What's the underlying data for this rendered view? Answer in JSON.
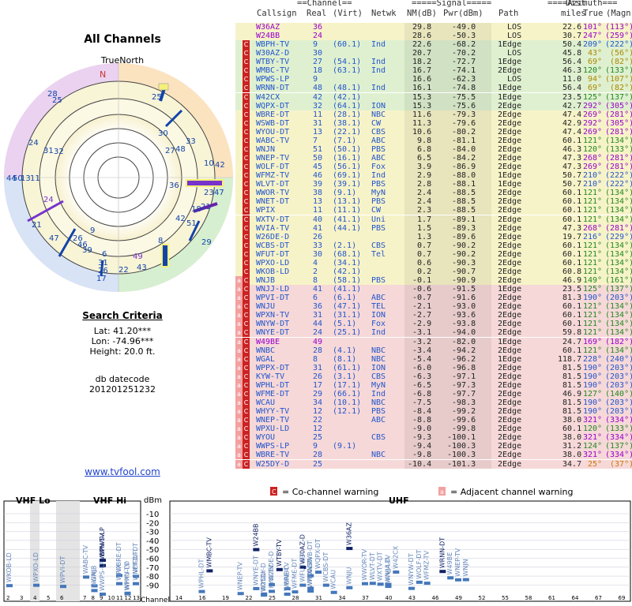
{
  "left_panel": {
    "title": "All Channels",
    "true_north_label": "TrueNorth",
    "north_marker": "N",
    "search_criteria_title": "Search Criteria",
    "lat": "Lat: 41.20***",
    "lon": "Lon: -74.96***",
    "height": "Height: 20.0 ft.",
    "db_label": "db datecode",
    "db_value": "201201251232",
    "website": "www.tvfool.com"
  },
  "table": {
    "group_headers": {
      "channel": "==Channel==",
      "signal": "=====Signal=====",
      "azimuth": "====Azimuth==="
    },
    "col_headers": {
      "callsign": "Callsign",
      "real": "Real",
      "virt": "(Virt)",
      "netwk": "Netwk",
      "nm": "NM(dB)",
      "pwr": "Pwr(dBm)",
      "path": "Path",
      "dist_top": "Dist",
      "dist": "miles",
      "true": "True",
      "magn": "(Magn)"
    },
    "rows": [
      [
        "",
        "W36AZ",
        "36",
        "",
        "",
        "29.8",
        "-49.0",
        "LOS",
        "22.6",
        "101°",
        "(113°)",
        "purple"
      ],
      [
        "",
        "W24BB",
        "24",
        "",
        "",
        "28.6",
        "-50.3",
        "LOS",
        "30.7",
        "247°",
        "(259°)",
        "purple"
      ],
      [
        "C",
        "WBPH-TV",
        "9",
        "(60.1)",
        "Ind",
        "22.6",
        "-68.2",
        "1Edge",
        "50.4",
        "209°",
        "(222°)",
        "blue"
      ],
      [
        "C",
        "W30AZ-D",
        "30",
        "",
        "",
        "20.7",
        "-70.2",
        "LOS",
        "45.8",
        "43°",
        "(56°)",
        "olive"
      ],
      [
        "C",
        "WTBY-TV",
        "27",
        "(54.1)",
        "Ind",
        "18.2",
        "-72.7",
        "1Edge",
        "56.4",
        "69°",
        "(82°)",
        "olive"
      ],
      [
        "C",
        "WMBC-TV",
        "18",
        "(63.1)",
        "Ind",
        "16.7",
        "-74.1",
        "2Edge",
        "46.3",
        "120°",
        "(133°)",
        "green"
      ],
      [
        "C",
        "WPWS-LP",
        "9",
        "",
        "",
        "16.6",
        "-62.3",
        "LOS",
        "11.0",
        "94°",
        "(107°)",
        "olive"
      ],
      [
        "C",
        "WRNN-DT",
        "48",
        "(48.1)",
        "Ind",
        "16.1",
        "-74.8",
        "1Edge",
        "56.4",
        "69°",
        "(82°)",
        "olive"
      ],
      [
        "C",
        "W42CX",
        "42",
        "(42.1)",
        "",
        "15.3",
        "-75.5",
        "1Edge",
        "23.5",
        "125°",
        "(137°)",
        "green"
      ],
      [
        "C",
        "WQPX-DT",
        "32",
        "(64.1)",
        "ION",
        "15.3",
        "-75.6",
        "2Edge",
        "42.7",
        "292°",
        "(305°)",
        "purple"
      ],
      [
        "C",
        "WBRE-DT",
        "11",
        "(28.1)",
        "NBC",
        "11.6",
        "-79.3",
        "2Edge",
        "47.4",
        "269°",
        "(281°)",
        "purple"
      ],
      [
        "C",
        "WSWB-DT",
        "31",
        "(38.1)",
        "CW",
        "11.3",
        "-79.6",
        "2Edge",
        "42.9",
        "292°",
        "(305°)",
        "purple"
      ],
      [
        "C",
        "WYOU-DT",
        "13",
        "(22.1)",
        "CBS",
        "10.6",
        "-80.2",
        "2Edge",
        "47.4",
        "269°",
        "(281°)",
        "purple"
      ],
      [
        "C",
        "WABC-TV",
        "7",
        "(7.1)",
        "ABC",
        "9.8",
        "-81.1",
        "2Edge",
        "60.1",
        "121°",
        "(134°)",
        "green"
      ],
      [
        "C",
        "WNJN",
        "51",
        "(50.1)",
        "PBS",
        "6.8",
        "-84.0",
        "2Edge",
        "46.3",
        "120°",
        "(133°)",
        "green"
      ],
      [
        "C",
        "WNEP-TV",
        "50",
        "(16.1)",
        "ABC",
        "6.5",
        "-84.2",
        "2Edge",
        "47.3",
        "268°",
        "(281°)",
        "purple"
      ],
      [
        "C",
        "WOLF-DT",
        "45",
        "(56.1)",
        "Fox",
        "3.9",
        "-86.9",
        "2Edge",
        "47.3",
        "269°",
        "(281°)",
        "purple"
      ],
      [
        "C",
        "WFMZ-TV",
        "46",
        "(69.1)",
        "Ind",
        "2.9",
        "-88.0",
        "1Edge",
        "50.7",
        "210°",
        "(222°)",
        "blue"
      ],
      [
        "C",
        "WLVT-DT",
        "39",
        "(39.1)",
        "PBS",
        "2.8",
        "-88.1",
        "1Edge",
        "50.7",
        "210°",
        "(222°)",
        "blue"
      ],
      [
        "C",
        "WWOR-TV",
        "38",
        "(9.1)",
        "MyN",
        "2.4",
        "-88.5",
        "2Edge",
        "60.1",
        "121°",
        "(134°)",
        "green"
      ],
      [
        "C",
        "WNET-DT",
        "13",
        "(13.1)",
        "PBS",
        "2.4",
        "-88.5",
        "2Edge",
        "60.1",
        "121°",
        "(134°)",
        "green"
      ],
      [
        "C",
        "WPIX",
        "11",
        "(11.1)",
        "CW",
        "2.3",
        "-88.5",
        "2Edge",
        "60.1",
        "121°",
        "(134°)",
        "green"
      ],
      [
        "C",
        "WXTV-DT",
        "40",
        "(41.1)",
        "Uni",
        "1.7",
        "-89.1",
        "2Edge",
        "60.1",
        "121°",
        "(134°)",
        "green"
      ],
      [
        "C",
        "WVIA-TV",
        "41",
        "(44.1)",
        "PBS",
        "1.5",
        "-89.3",
        "2Edge",
        "47.3",
        "268°",
        "(281°)",
        "purple"
      ],
      [
        "C",
        "W26DE-D",
        "26",
        "",
        "",
        "1.3",
        "-89.6",
        "2Edge",
        "19.7",
        "216°",
        "(229°)",
        "blue"
      ],
      [
        "C",
        "WCBS-DT",
        "33",
        "(2.1)",
        "CBS",
        "0.7",
        "-90.2",
        "2Edge",
        "60.1",
        "121°",
        "(134°)",
        "green"
      ],
      [
        "C",
        "WFUT-DT",
        "30",
        "(68.1)",
        "Tel",
        "0.7",
        "-90.2",
        "2Edge",
        "60.1",
        "121°",
        "(134°)",
        "green"
      ],
      [
        "C",
        "WPXO-LD",
        "4",
        "(34.1)",
        "",
        "0.6",
        "-90.3",
        "2Edge",
        "60.1",
        "121°",
        "(134°)",
        "green"
      ],
      [
        "C",
        "WKOB-LD",
        "2",
        "(42.1)",
        "",
        "0.2",
        "-90.7",
        "2Edge",
        "60.8",
        "121°",
        "(134°)",
        "green"
      ],
      [
        "AC",
        "WNJB",
        "8",
        "(58.1)",
        "PBS",
        "-0.1",
        "-90.9",
        "2Edge",
        "46.9",
        "149°",
        "(161°)",
        "green"
      ],
      [
        "AC",
        "WNJJ-LD",
        "41",
        "(41.1)",
        "",
        "-0.6",
        "-91.5",
        "1Edge",
        "23.5",
        "125°",
        "(137°)",
        "green"
      ],
      [
        "AC",
        "WPVI-DT",
        "6",
        "(6.1)",
        "ABC",
        "-0.7",
        "-91.6",
        "2Edge",
        "81.3",
        "190°",
        "(203°)",
        "blue"
      ],
      [
        "AC",
        "WNJU",
        "36",
        "(47.1)",
        "TEL",
        "-2.1",
        "-93.0",
        "2Edge",
        "60.1",
        "121°",
        "(134°)",
        "green"
      ],
      [
        "AC",
        "WPXN-TV",
        "31",
        "(31.1)",
        "ION",
        "-2.7",
        "-93.6",
        "2Edge",
        "60.1",
        "121°",
        "(134°)",
        "green"
      ],
      [
        "AC",
        "WNYW-DT",
        "44",
        "(5.1)",
        "Fox",
        "-2.9",
        "-93.8",
        "2Edge",
        "60.1",
        "121°",
        "(134°)",
        "green"
      ],
      [
        "AC",
        "WNYE-DT",
        "24",
        "(25.1)",
        "Ind",
        "-3.1",
        "-94.0",
        "2Edge",
        "59.8",
        "121°",
        "(134°)",
        "green"
      ],
      [
        "AC",
        "W49BE",
        "49",
        "",
        "",
        "-3.2",
        "-82.0",
        "1Edge",
        "24.7",
        "169°",
        "(182°)",
        "purple"
      ],
      [
        "AC",
        "WNBC",
        "28",
        "(4.1)",
        "NBC",
        "-3.4",
        "-94.2",
        "2Edge",
        "60.1",
        "121°",
        "(134°)",
        "green"
      ],
      [
        "AC",
        "WGAL",
        "8",
        "(8.1)",
        "NBC",
        "-5.4",
        "-96.2",
        "1Edge",
        "118.7",
        "228°",
        "(240°)",
        "blue"
      ],
      [
        "AC",
        "WPPX-DT",
        "31",
        "(61.1)",
        "ION",
        "-6.0",
        "-96.8",
        "2Edge",
        "81.5",
        "190°",
        "(203°)",
        "blue"
      ],
      [
        "AC",
        "KYW-TV",
        "26",
        "(3.1)",
        "CBS",
        "-6.3",
        "-97.1",
        "2Edge",
        "81.5",
        "190°",
        "(203°)",
        "blue"
      ],
      [
        "AC",
        "WPHL-DT",
        "17",
        "(17.1)",
        "MyN",
        "-6.5",
        "-97.3",
        "2Edge",
        "81.5",
        "190°",
        "(203°)",
        "blue"
      ],
      [
        "AC",
        "WFME-DT",
        "29",
        "(66.1)",
        "Ind",
        "-6.8",
        "-97.7",
        "2Edge",
        "46.9",
        "127°",
        "(140°)",
        "green"
      ],
      [
        "AC",
        "WCAU",
        "34",
        "(10.1)",
        "NBC",
        "-7.5",
        "-98.3",
        "2Edge",
        "81.5",
        "190°",
        "(203°)",
        "blue"
      ],
      [
        "AC",
        "WHYY-TV",
        "12",
        "(12.1)",
        "PBS",
        "-8.4",
        "-99.2",
        "2Edge",
        "81.5",
        "190°",
        "(203°)",
        "blue"
      ],
      [
        "AC",
        "WNEP-TV",
        "22",
        "",
        "ABC",
        "-8.8",
        "-99.6",
        "2Edge",
        "38.0",
        "321°",
        "(334°)",
        "purple"
      ],
      [
        "AC",
        "WPXU-LD",
        "12",
        "",
        "",
        "-9.0",
        "-99.8",
        "2Edge",
        "60.1",
        "120°",
        "(133°)",
        "green"
      ],
      [
        "AC",
        "WYOU",
        "25",
        "",
        "CBS",
        "-9.3",
        "-100.1",
        "2Edge",
        "38.0",
        "321°",
        "(334°)",
        "purple"
      ],
      [
        "AC",
        "WWPS-LP",
        "9",
        "(9.1)",
        "",
        "-9.4",
        "-100.3",
        "2Edge",
        "31.2",
        "124°",
        "(137°)",
        "green"
      ],
      [
        "AC",
        "WBRE-TV",
        "28",
        "",
        "NBC",
        "-9.8",
        "-100.3",
        "2Edge",
        "38.0",
        "321°",
        "(334°)",
        "purple"
      ],
      [
        "AC",
        "W25DY-D",
        "25",
        "",
        "",
        "-10.4",
        "-101.3",
        "2Edge",
        "34.7",
        "25°",
        "(37°)",
        "orange"
      ]
    ]
  },
  "bottom": {
    "vhf_lo_label": "VHF Lo",
    "vhf_hi_label": "VHF Hi",
    "uhf_label": "UHF",
    "dbm_label": "dBm",
    "channel_label": "Channel",
    "legend_co": "= Co-channel warning",
    "legend_adj": "= Adjacent channel warning",
    "legend_co_badge": "C",
    "legend_adj_badge": "a",
    "db_ticks": [
      "-10",
      "-20",
      "-30",
      "-40",
      "-50",
      "-60",
      "-70",
      "-80",
      "-90"
    ],
    "vhf_lo_channels": [
      "2",
      "3",
      "4",
      "5",
      "6"
    ],
    "vhf_hi_channels": [
      "7",
      "8",
      "9",
      "10",
      "11",
      "12",
      "13"
    ],
    "uhf_channels": [
      "14",
      "16",
      "19",
      "22",
      "25",
      "28",
      "31",
      "34",
      "37",
      "40",
      "43",
      "46",
      "49",
      "52",
      "55",
      "58",
      "61",
      "64",
      "67",
      "69"
    ]
  },
  "colors": {
    "green_row": "#dff0d0",
    "yellow_row": "#f7f3c8",
    "red_row": "#f6d8d8",
    "callsign_purple": "#9900cc",
    "callsign_blue": "#2255cc",
    "callsign_gray": "#6688bb"
  }
}
